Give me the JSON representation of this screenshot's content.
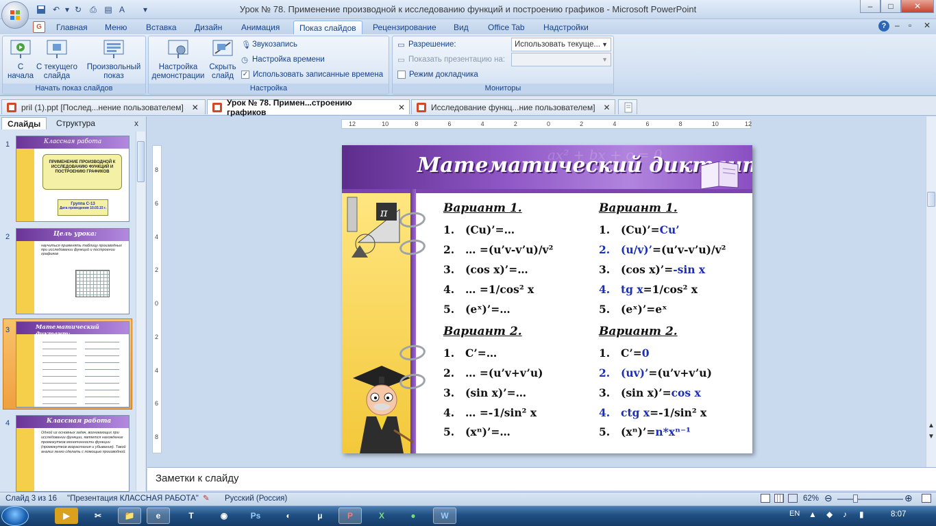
{
  "window": {
    "title": "Урок № 78. Применение производной к исследованию функций и построению графиков - Microsoft PowerPoint",
    "buttons": [
      "–",
      "□",
      "✕"
    ]
  },
  "ribbon": {
    "tabs": [
      "Главная",
      "Меню",
      "Вставка",
      "Дизайн",
      "Анимация",
      "Показ слайдов",
      "Рецензирование",
      "Вид",
      "Office Tab",
      "Надстройки"
    ],
    "active_tab": "Показ слайдов",
    "groups": {
      "start": {
        "label": "Начать показ слайдов",
        "from_start": "С начала",
        "from_current": "С текущего слайда",
        "custom": "Произвольный показ"
      },
      "setup": {
        "label": "Настройка",
        "setup_show": "Настройка демонстрации",
        "hide_slide": "Скрыть слайд",
        "record_narration": "Звукозапись",
        "rehearse": "Настройка времени",
        "use_timings": "Использовать записанные времена"
      },
      "monitors": {
        "label": "Мониторы",
        "resolution_label": "Разрешение:",
        "resolution_value": "Использовать текуще...",
        "show_on_label": "Показать презентацию на:",
        "presenter_view": "Режим докладчика"
      }
    }
  },
  "doc_tabs": [
    {
      "label": "pril (1).ppt [Послед...нение пользователем]"
    },
    {
      "label": "Урок № 78. Примен...строению графиков"
    },
    {
      "label": "Исследование функц...ние пользователем]"
    }
  ],
  "panel": {
    "tab_slides": "Слайды",
    "tab_outline": "Структура",
    "close": "x",
    "thumbs": [
      {
        "num": "1",
        "title": "Классная работа",
        "box": "ПРИМЕНЕНИЕ ПРОИЗВОДНОЙ К ИССЛЕДОВАНИЮ ФУНКЦИЙ И ПОСТРОЕНИЮ ГРАФИКОВ",
        "sub": "Группа С-13",
        "date": "Дата проведения 10.03.15 г."
      },
      {
        "num": "2",
        "title": "Цель урока:",
        "text": "научиться применять таблицу производных при исследовании функций и построении графиков"
      },
      {
        "num": "3",
        "title": "Математический диктант:"
      },
      {
        "num": "4",
        "title": "Классная работа",
        "text": "Одной из основных задач, возникающих при исследовании функции, является нахождение промежутков монотонности функции (промежутков возрастания и убывания). Такой анализ легко сделать с помощью производной."
      }
    ]
  },
  "ruler": {
    "h_ticks": [
      "12",
      "10",
      "8",
      "6",
      "4",
      "2",
      "0",
      "2",
      "4",
      "6",
      "8",
      "10",
      "12"
    ],
    "v_ticks": [
      "8",
      "6",
      "4",
      "2",
      "0",
      "2",
      "4",
      "6",
      "8"
    ]
  },
  "slide": {
    "title": "Математический диктант:",
    "col1_v1_head": "Вариант 1.",
    "col1_v1": [
      {
        "n": "1.",
        "t": "(Cu)’=…"
      },
      {
        "n": "2.",
        "t": "… =(u’v-v’u)/v²"
      },
      {
        "n": "3.",
        "t": "(cos x)’=…"
      },
      {
        "n": "4.",
        "t": "… =1/cos² x"
      },
      {
        "n": "5.",
        "t": "(eˣ)’=…"
      }
    ],
    "col1_v2_head": "Вариант 2.",
    "col1_v2": [
      {
        "n": "1.",
        "t": "C’=…"
      },
      {
        "n": "2.",
        "t": "… =(u’v+v’u)"
      },
      {
        "n": "3.",
        "t": "(sin x)’=…"
      },
      {
        "n": "4.",
        "t": "… =-1/sin² x"
      },
      {
        "n": "5.",
        "t": "(xⁿ)’=…"
      }
    ],
    "col2_v1_head": "Вариант 1.",
    "col2_v1": [
      {
        "n": "1.",
        "a": "(Cu)’=",
        "b": "Cu’",
        "c": ""
      },
      {
        "n": "2.",
        "a": "",
        "b": "(u/v)’",
        "c": "=(u’v-v’u)/v²"
      },
      {
        "n": "3.",
        "a": "(cos x)’=",
        "b": "-sin x",
        "c": ""
      },
      {
        "n": "4.",
        "a": "",
        "b": "tg x",
        "c": "=1/cos² x"
      },
      {
        "n": "5.",
        "a": "(eˣ)’=eˣ",
        "b": "",
        "c": ""
      }
    ],
    "col2_v2_head": "Вариант 2.",
    "col2_v2": [
      {
        "n": "1.",
        "a": "C’=",
        "b": "0",
        "c": ""
      },
      {
        "n": "2.",
        "a": "",
        "b": "(uv)’",
        "c": "=(u’v+v’u)"
      },
      {
        "n": "3.",
        "a": "(sin x)’=",
        "b": "cos x",
        "c": ""
      },
      {
        "n": "4.",
        "a": "",
        "b": "ctg x",
        "c": "=-1/sin² x"
      },
      {
        "n": "5.",
        "a": "(xⁿ)’=",
        "b": "n*xⁿ⁻¹",
        "c": ""
      }
    ]
  },
  "notes": {
    "placeholder": "Заметки к слайду"
  },
  "status": {
    "slide_pos": "Слайд 3 из 16",
    "theme": "\"Презентация КЛАССНАЯ РАБОТА\"",
    "language": "Русский (Россия)",
    "zoom": "62%"
  },
  "taskbar": {
    "lang": "EN",
    "time": "8:07"
  },
  "colors": {
    "accent_blue": "#1b2fb0",
    "slide_purple": "#8f57c6",
    "slide_yellow": "#f3c83a"
  }
}
